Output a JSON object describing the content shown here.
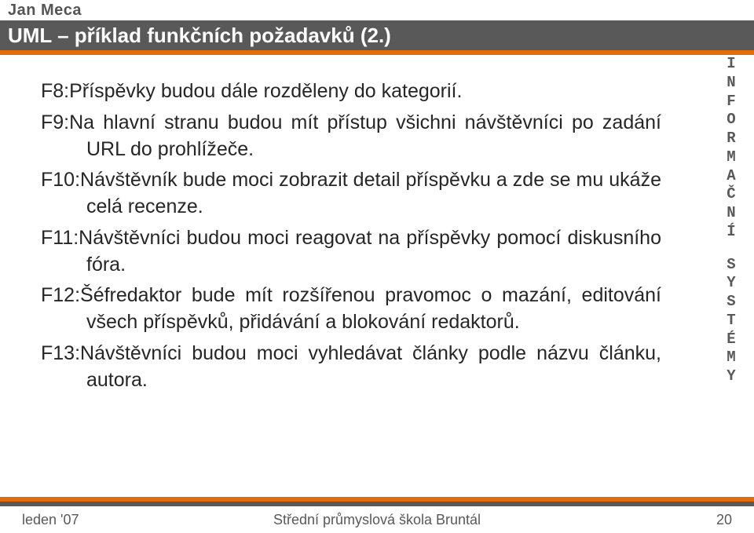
{
  "author": "Jan Meca",
  "title": "UML – příklad funkčních požadavků (2.)",
  "side_label_top": "INFORMAČNÍ",
  "side_label_bottom": "SYSTÉMY",
  "items": {
    "f8": "F8:Příspěvky budou dále rozděleny do kategorií.",
    "f9": "F9:Na hlavní stranu budou mít přístup všichni návštěvníci po zadání URL do prohlížeče.",
    "f10": "F10:Návštěvník bude moci zobrazit detail příspěvku a zde se mu ukáže celá recenze.",
    "f11": "F11:Návštěvníci budou moci reagovat na příspěvky pomocí diskusního fóra.",
    "f12": "F12:Šéfredaktor bude mít rozšířenou pravomoc o mazání, editování všech příspěvků, přidávání a blokování redaktorů.",
    "f13": "F13:Návštěvníci budou moci vyhledávat články podle názvu článku, autora."
  },
  "footer": {
    "left": "leden '07",
    "center": "Střední průmyslová škola Bruntál",
    "right": "20"
  }
}
